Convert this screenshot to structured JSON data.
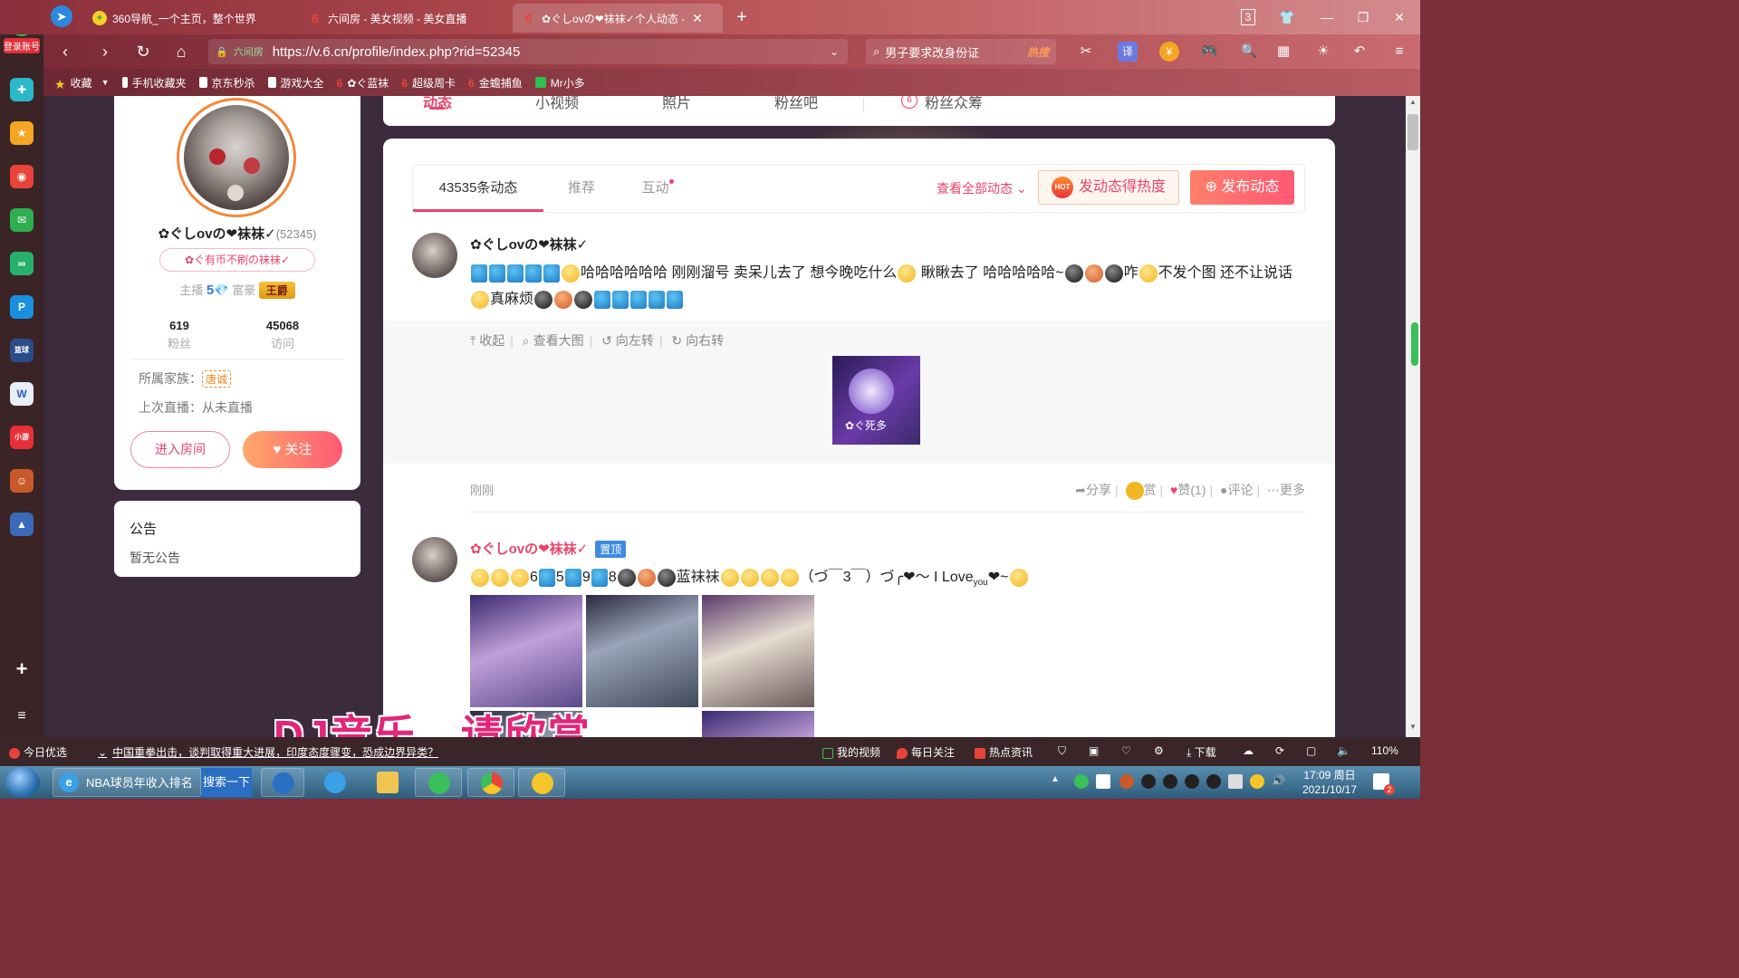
{
  "browser": {
    "tabs": [
      {
        "title": "360导航_一个主页，整个世界"
      },
      {
        "title": "六间房 - 美女视频 - 美女直播"
      },
      {
        "title": "✿ぐしovの❤袜袜✓个人动态 - "
      }
    ],
    "new_tab": "+",
    "tab_counter": "3",
    "url": "https://v.6.cn/profile/index.php?rid=52345",
    "site_badge": "六间房",
    "search_text": "男子要求改身份证",
    "search_hot": "热搜",
    "sidebar_login": "登录账号",
    "zoom": "110%"
  },
  "bookmarks": [
    {
      "label": "收藏"
    },
    {
      "label": "手机收藏夹"
    },
    {
      "label": "京东秒杀"
    },
    {
      "label": "游戏大全"
    },
    {
      "label": "✿ぐ蓝袜"
    },
    {
      "label": "超级周卡"
    },
    {
      "label": "金蟾捕鱼"
    },
    {
      "label": "Mr小多"
    }
  ],
  "profile_nav": [
    "动态",
    "小视频",
    "照片",
    "粉丝吧",
    "粉丝众筹"
  ],
  "profile": {
    "name": "✿ぐしovの❤袜袜✓",
    "rid": "(52345)",
    "signature": "✿ぐ有币不刷の袜袜✓",
    "anchor_label": "主播",
    "anchor_level": "5",
    "rich_label": "富豪",
    "rich_badge": "王爵",
    "fans_count": "619",
    "fans_label": "粉丝",
    "visits_count": "45068",
    "visits_label": "访问",
    "family_label": "所属家族：",
    "family_tag": "唐诚",
    "last_live": "上次直播：从未直播",
    "enter_room": "进入房间",
    "follow": "关注"
  },
  "notice": {
    "title": "公告",
    "body": "暂无公告"
  },
  "feed": {
    "tabs": [
      "43535条动态",
      "推荐",
      "互动"
    ],
    "view_all": "查看全部动态",
    "hot_button": "发动态得热度",
    "hot_icon": "HOT",
    "post_button": "发布动态",
    "posts": [
      {
        "author": "✿ぐしovの❤袜袜✓",
        "text_a": "哈哈哈哈哈哈 刚刚溜号 卖呆儿去了 想今晚吃什么",
        "text_b": " 瞅瞅去了 哈哈哈哈哈~",
        "text_c": "咋",
        "text_d": "不发个图 还不让说话",
        "text_e": "真麻烦",
        "actions": [
          "收起",
          "查看大图",
          "向左转",
          "向右转"
        ],
        "image_caption": "✿ぐ死多",
        "time": "刚刚",
        "share": "分享",
        "reward": "赏",
        "like": "赞(1)",
        "comment": "评论",
        "more": "更多"
      },
      {
        "author": "✿ぐしovの❤袜袜✓",
        "pinned": "置顶",
        "seq": [
          "6",
          "5",
          "9",
          "8"
        ],
        "text_a": "蓝袜袜",
        "text_b": "（づ￣3￣）づ╭❤～ I Love",
        "text_sub": "you",
        "text_c": "❤~"
      }
    ]
  },
  "overlay_caption": "DJ音乐，请欣赏",
  "statusbar": {
    "left": "今日优选",
    "news": "中国重拳出击，谈判取得重大进展，印度态度骤变，恐成边界异类？",
    "items": [
      "我的视频",
      "每日关注",
      "热点资讯",
      "下载"
    ]
  },
  "taskbar": {
    "task_title": "NBA球员年收入排名",
    "search_btn": "搜索一下",
    "time": "17:09 周日",
    "date": "2021/10/17",
    "notif_count": "2"
  },
  "colors": {
    "accent": "#e9446a",
    "follow_gradient_start": "#ffa86a",
    "pin_blue": "#3f8ce0"
  }
}
